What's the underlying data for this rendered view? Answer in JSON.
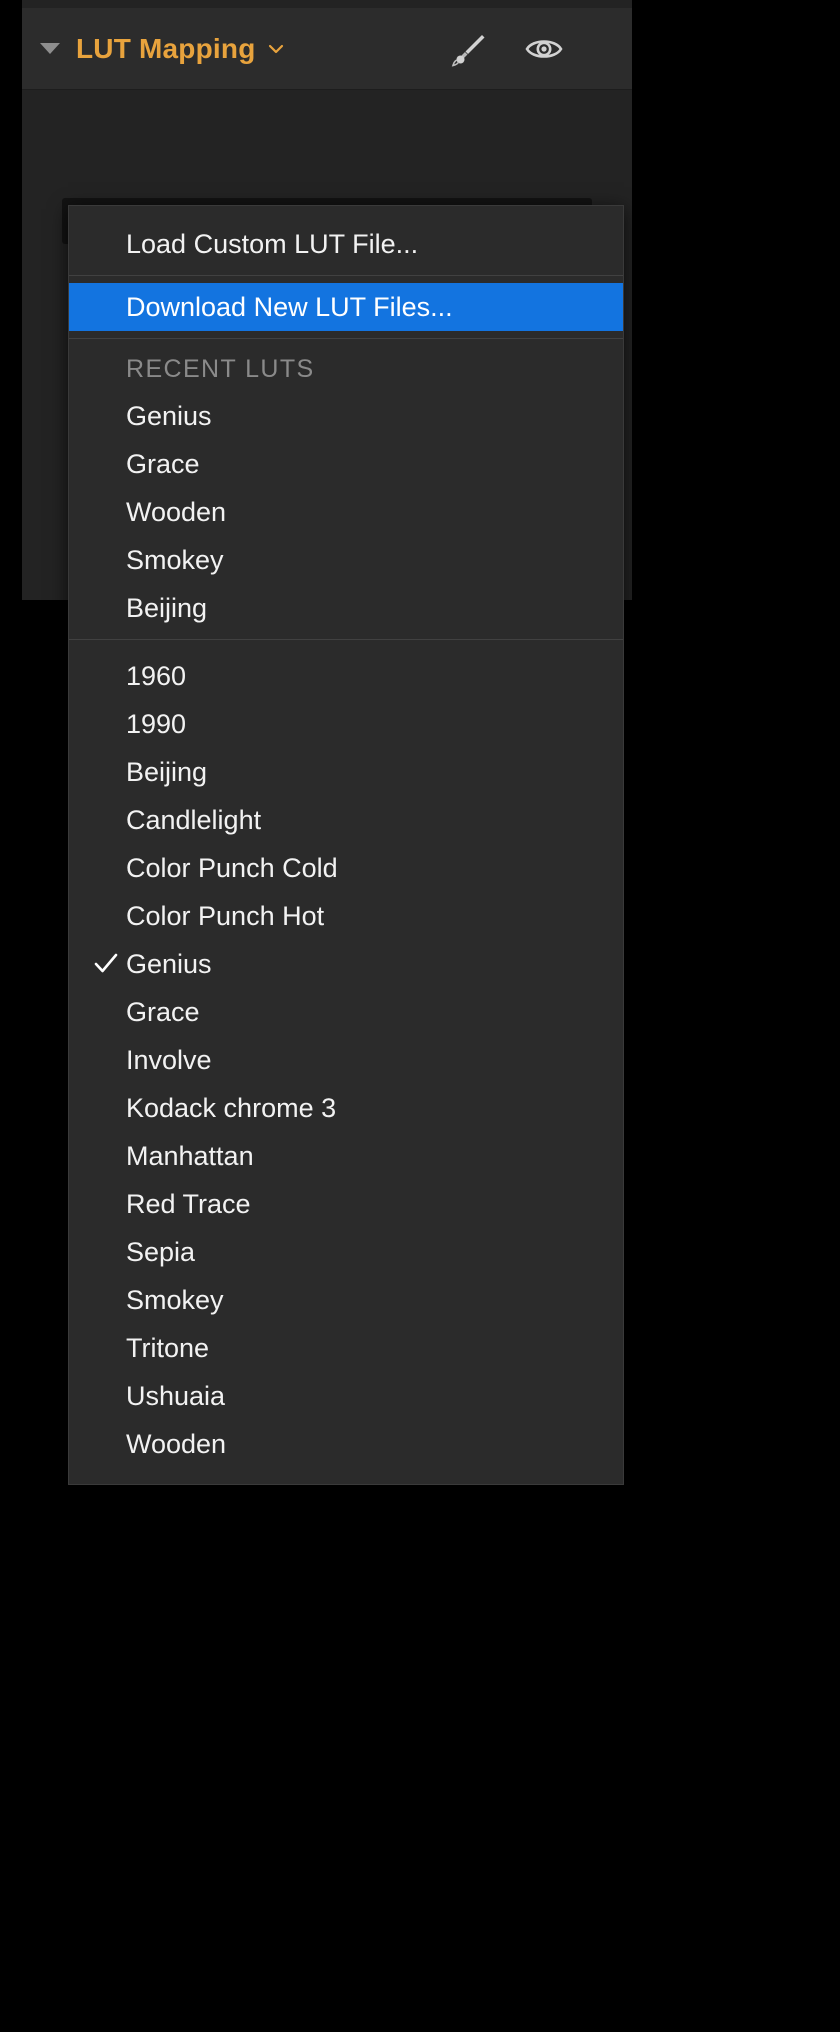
{
  "panel": {
    "title": "LUT Mapping",
    "title_color": "#e8a33d",
    "disclosure_icon": "triangle-down-icon",
    "title_chevron_icon": "chevron-down-icon",
    "icons": [
      {
        "name": "brush-icon",
        "label": "Brush"
      },
      {
        "name": "eye-icon",
        "label": "Visibility"
      }
    ]
  },
  "preset_dropdown": {
    "value": "Genius",
    "chevron_icon": "chevron-down-icon",
    "accent_color": "#e8a33d"
  },
  "menu": {
    "highlight_color": "#1374e0",
    "actions": [
      {
        "label": "Load Custom LUT File...",
        "highlighted": false
      },
      {
        "label": "Download New LUT Files...",
        "highlighted": true
      }
    ],
    "recent_section": {
      "header": "RECENT LUTS",
      "items": [
        {
          "label": "Genius"
        },
        {
          "label": "Grace"
        },
        {
          "label": "Wooden"
        },
        {
          "label": "Smokey"
        },
        {
          "label": "Beijing"
        }
      ]
    },
    "all_luts": [
      {
        "label": "1960",
        "checked": false
      },
      {
        "label": "1990",
        "checked": false
      },
      {
        "label": "Beijing",
        "checked": false
      },
      {
        "label": "Candlelight",
        "checked": false
      },
      {
        "label": "Color Punch Cold",
        "checked": false
      },
      {
        "label": "Color Punch Hot",
        "checked": false
      },
      {
        "label": "Genius",
        "checked": true
      },
      {
        "label": "Grace",
        "checked": false
      },
      {
        "label": "Involve",
        "checked": false
      },
      {
        "label": "Kodack chrome  3",
        "checked": false
      },
      {
        "label": "Manhattan",
        "checked": false
      },
      {
        "label": "Red Trace",
        "checked": false
      },
      {
        "label": "Sepia",
        "checked": false
      },
      {
        "label": "Smokey",
        "checked": false
      },
      {
        "label": "Tritone",
        "checked": false
      },
      {
        "label": "Ushuaia",
        "checked": false
      },
      {
        "label": "Wooden",
        "checked": false
      }
    ]
  }
}
